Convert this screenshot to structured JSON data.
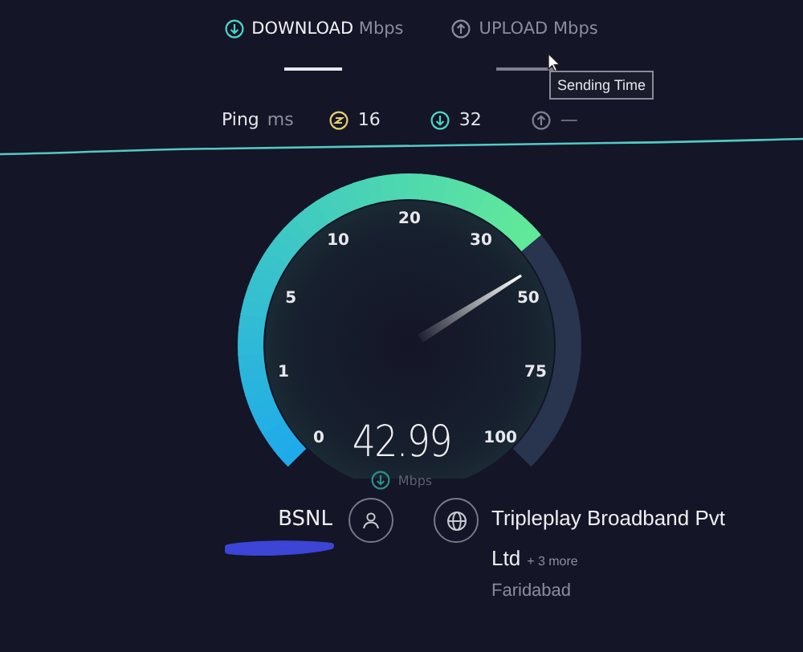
{
  "tabs": [
    {
      "label": "DOWNLOAD",
      "unit": "Mbps",
      "kind": "download",
      "selected": true
    },
    {
      "label": "UPLOAD",
      "unit": "Mbps",
      "kind": "upload",
      "selected": false
    }
  ],
  "tooltip": "Sending Time",
  "ping": {
    "label": "Ping",
    "unit": "ms",
    "stats": [
      {
        "kind": "idle",
        "value": "16"
      },
      {
        "kind": "download",
        "value": "32"
      },
      {
        "kind": "upload",
        "value": "—"
      }
    ]
  },
  "gauge": {
    "ticks": [
      "0",
      "1",
      "5",
      "10",
      "20",
      "30",
      "50",
      "75",
      "100"
    ],
    "value": "42.99",
    "unit": "Mbps"
  },
  "server": {
    "provider": "BSNL",
    "isp": "Tripleplay Broadband Pvt Ltd",
    "more": "+ 3 more",
    "location": "Faridabad"
  }
}
